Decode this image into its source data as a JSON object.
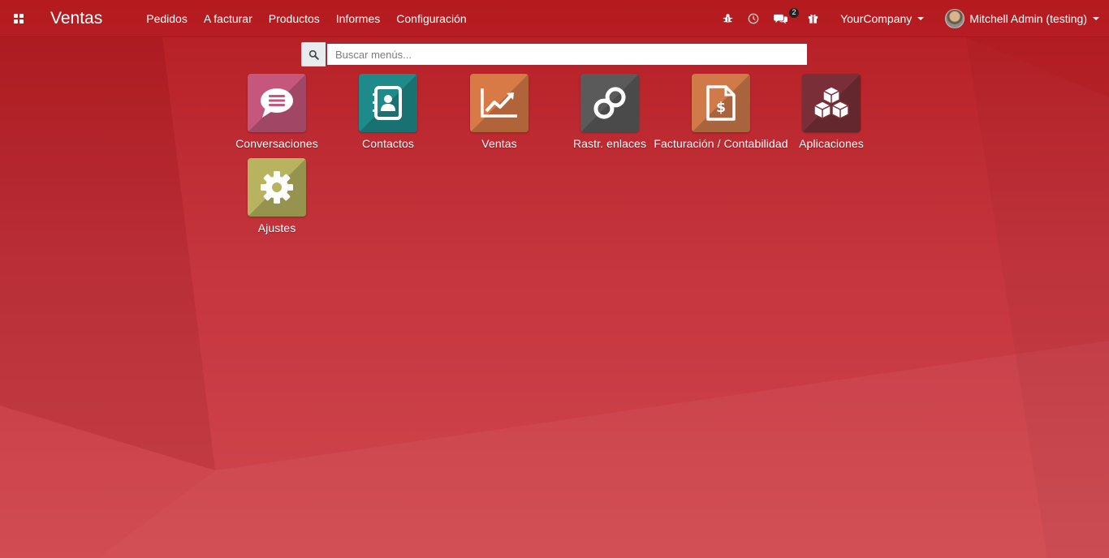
{
  "navbar": {
    "apps_icon": "grid-icon",
    "brand": "Ventas",
    "menu": [
      {
        "label": "Pedidos"
      },
      {
        "label": "A facturar"
      },
      {
        "label": "Productos"
      },
      {
        "label": "Informes"
      },
      {
        "label": "Configuración"
      }
    ],
    "systray": {
      "debug_icon": "bug-icon",
      "activity_icon": "clock-icon",
      "messages_icon": "chat-icon",
      "messages_count": "2",
      "gift_icon": "gift-icon",
      "company": "YourCompany",
      "user": "Mitchell Admin (testing)"
    }
  },
  "search": {
    "placeholder": "Buscar menús...",
    "icon": "search-icon"
  },
  "apps": [
    {
      "label": "Conversaciones",
      "icon": "chat-bubble-icon",
      "color": "#c4577b"
    },
    {
      "label": "Contactos",
      "icon": "address-book-icon",
      "color": "#1e8a8a"
    },
    {
      "label": "Ventas",
      "icon": "line-chart-icon",
      "color": "#d87a45"
    },
    {
      "label": "Rastr. enlaces",
      "icon": "link-icon",
      "color": "#5a5a5a"
    },
    {
      "label": "Facturación / Contabilidad",
      "icon": "invoice-dollar-icon",
      "color": "#d07a4a"
    },
    {
      "label": "Aplicaciones",
      "icon": "cubes-icon",
      "color": "#7a2f38"
    },
    {
      "label": "Ajustes",
      "icon": "gear-icon",
      "color": "#b7b35f"
    }
  ]
}
